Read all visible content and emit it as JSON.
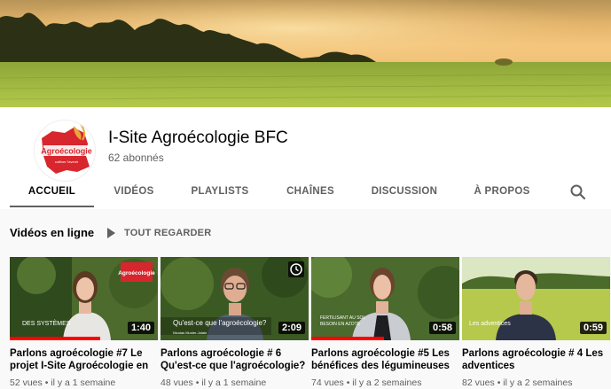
{
  "channel": {
    "name": "I-Site Agroécologie BFC",
    "subscribers": "62 abonnés",
    "logo_text": "Agroécologie",
    "logo_sub": "cultiver l'avenir"
  },
  "tabs": [
    {
      "label": "ACCUEIL",
      "active": true
    },
    {
      "label": "VIDÉOS"
    },
    {
      "label": "PLAYLISTS"
    },
    {
      "label": "CHAÎNES"
    },
    {
      "label": "DISCUSSION"
    },
    {
      "label": "À PROPOS"
    }
  ],
  "section": {
    "title": "Vidéos en ligne",
    "play_all": "TOUT REGARDER"
  },
  "videos": [
    {
      "title": "Parlons agroécologie #7 Le projet I-Site Agroécologie en",
      "meta": "52 vues • il y a 1 semaine",
      "duration": "1:40",
      "caption": "DES SYSTÈMES"
    },
    {
      "title": "Parlons agroécologie # 6 Qu'est-ce que l'agroécologie?",
      "meta": "48 vues • il y a 1 semaine",
      "duration": "2:09",
      "caption": "Qu'est-ce que l'agroécologie?",
      "caption2": "Nicolas Munier-Jolain"
    },
    {
      "title": "Parlons agroécologie #5 Les bénéfices des légumineuses",
      "meta": "74 vues • il y a 2 semaines",
      "duration": "0:58",
      "caption": "FERTILISANT AU SOL",
      "caption2": "BESOIN EN AZOTE"
    },
    {
      "title": "Parlons agroécologie # 4 Les adventices",
      "meta": "82 vues • il y a 2 semaines",
      "duration": "0:59",
      "caption": "Les adventices"
    }
  ],
  "colors": {
    "accent_red": "#ff0000",
    "logo_red": "#d7262d"
  }
}
